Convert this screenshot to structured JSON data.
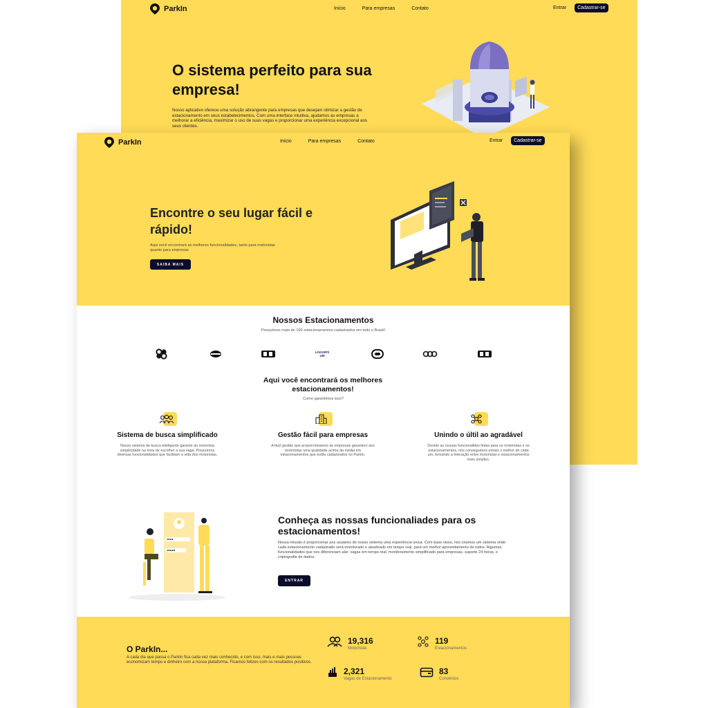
{
  "brand": "ParkIn",
  "nav": {
    "links": [
      "Início",
      "Para empresas",
      "Contato"
    ],
    "login": "Entrar",
    "signup": "Cadastrar-se"
  },
  "back_page": {
    "hero_title": "O sistema perfeito para sua empresa!",
    "hero_text": "Nosso aplicativo oferece uma solução abrangente para empresas que desejam otimizar a gestão de estacionamento em seus estabelecimentos. Com uma interface intuitiva, ajudamos as empresas a melhorar a eficiência, maximizar o uso de suas vagas e proporcionar uma experiência excepcional aos seus clientes."
  },
  "front_page": {
    "hero_title": "Encontre o seu lugar fácil e rápido!",
    "hero_text": "Aqui você encontrará as melhores funcionalidades, tanto para motoristas quanto para empresas",
    "hero_button": "SAIBA MAIS",
    "parking": {
      "title": "Nossos Estacionamentos",
      "subtitle": "Possuímos mais de 100 estacionamentos cadastrados em todo o Brasil!",
      "logo_text": "LOGOIPSUM"
    },
    "best": {
      "title": "Aqui você encontrará os melhores estacionamentos!",
      "subtitle": "Como garantimos isso?"
    },
    "features": [
      {
        "title": "Sistema de busca simplificado",
        "text": "Nosso sistema de busca inteligente garante ao motorista simplicidade na hora de escolher a sua vaga. Possuímos diversas funcionalidades que facilitam a vida dos motoristas.",
        "icon": "group-icon"
      },
      {
        "title": "Gestão fácil para empresas",
        "text": "A fácil gestão que proporcionamos às empresas garantem aos motoristas uma qualidade acima da média em estacionamentos que estão cadastrados no ParkIn.",
        "icon": "buildings-icon"
      },
      {
        "title": "Unindo o últil ao agradável",
        "text": "Devido as nossas funcionalides feitas para os motoristas e os estacionamentos, nós conseguimos extrair o melhor de cada um, tornando a interação entre motoristas e estacionamentos mais simples.",
        "icon": "connection-icon"
      }
    ],
    "functions": {
      "title": "Conheça as nossas funcionaliades para os estacionamentos!",
      "text": "Nossa missão é proporcionar aos usuários do nosso sistema uma experiência única. Com base nisso, nós criamos um sistema onde cada estacionamento cadastrado será monitorado e atualizado em tempo real, para um melhor aproveitamento de todos. Algumas funcionalidades que nos diferenciam são: vagas em tempo real, monitoramento simplificado para empresas, suporte 24 horas, e criptografia de dados.",
      "button": "ENTRAR"
    },
    "about": {
      "title": "O ParkIn...",
      "text": "A cada dia que passa o ParkIn fica cada vez mais conhecido, e com isso, mais e mais pessoas economizam tempo e dinheiro com a nossa plataforma. Ficamos felizes com os resultados positivos."
    },
    "stats": [
      {
        "value": "19,316",
        "label": "Motoristas",
        "icon": "users-icon"
      },
      {
        "value": "119",
        "label": "Estacionamentos",
        "icon": "network-icon"
      },
      {
        "value": "2,321",
        "label": "Vagas de Estacionamento",
        "icon": "growth-hand-icon"
      },
      {
        "value": "83",
        "label": "Convênios",
        "icon": "card-icon"
      }
    ]
  },
  "colors": {
    "accent": "#ffdb57",
    "dark": "#0c0c2a"
  }
}
